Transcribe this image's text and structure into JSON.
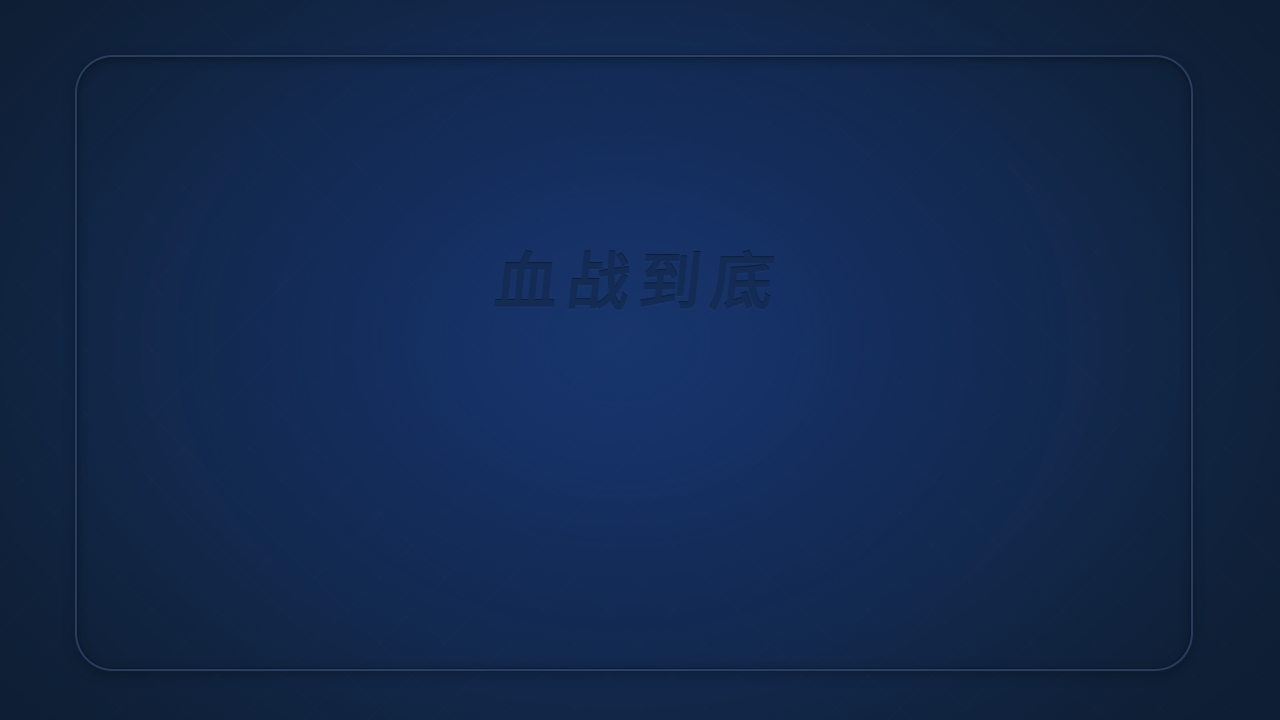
{
  "table": {
    "title": "血战到底"
  },
  "colors": {
    "background": "#132a52",
    "table_center": "#17336a",
    "frame_border": "#3c557d",
    "title_text": "#142b54"
  }
}
